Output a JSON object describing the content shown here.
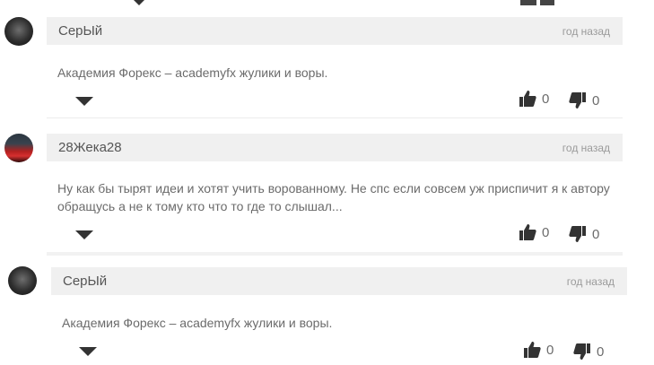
{
  "comments": [
    {
      "author": "СерЫй",
      "time": "год назад",
      "text": "Академия Форекс – academyfx жулики и воры.",
      "likes": "0",
      "dislikes": "0"
    },
    {
      "author": "28Жека28",
      "time": "год назад",
      "text": "Ну как бы тырят идеи и хотят учить ворованному. Не спс если совсем уж приспичит я к автору обращусь а не к тому кто что то где то слышал...",
      "likes": "0",
      "dislikes": "0"
    },
    {
      "author": "СерЫй",
      "time": "год назад",
      "text": "Академия Форекс – academyfx жулики и воры.",
      "likes": "0",
      "dislikes": "0"
    }
  ],
  "icons": {
    "like": "thumbs-up-icon",
    "dislike": "thumbs-down-icon",
    "expand": "caret-down-icon"
  },
  "colors": {
    "bar_bg": "#f0f0f0",
    "icon": "#333333",
    "text": "#6b6b6b"
  }
}
